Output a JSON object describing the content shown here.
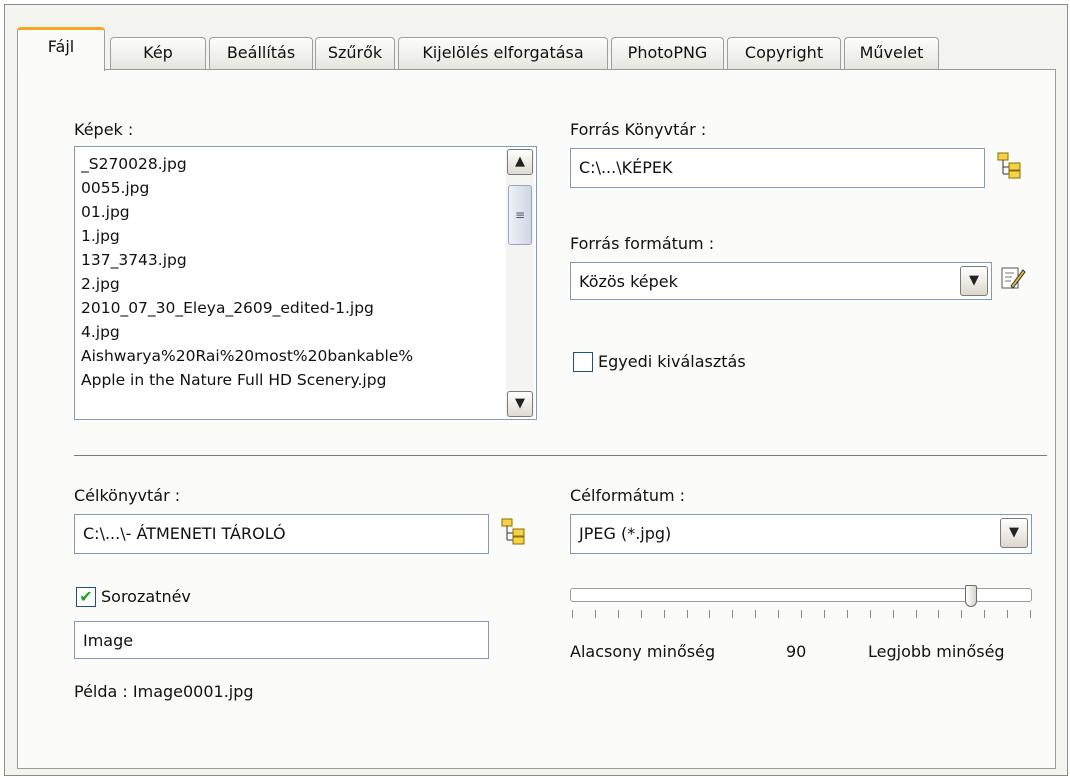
{
  "tabs": [
    "Fájl",
    "Kép",
    "Beállítás",
    "Szűrők",
    "Kijelölés elforgatása",
    "PhotoPNG",
    "Copyright",
    "Művelet"
  ],
  "active_tab": "Fájl",
  "images": {
    "label": "Képek :",
    "items": [
      "_S270028.jpg",
      "0055.jpg",
      "01.jpg",
      "1.jpg",
      "137_3743.jpg",
      "2.jpg",
      "2010_07_30_Eleya_2609_edited-1.jpg",
      "4.jpg",
      "Aishwarya%20Rai%20most%20bankable%",
      "Apple in the Nature Full HD Scenery.jpg"
    ]
  },
  "source_dir": {
    "label": "Forrás Könyvtár :",
    "value": "C:\\...\\KÉPEK"
  },
  "source_format": {
    "label": "Forrás formátum :",
    "value": "Közös képek"
  },
  "custom_select": {
    "label": "Egyedi kiválasztás",
    "checked": false
  },
  "target_dir": {
    "label": "Célkönyvtár :",
    "value": "C:\\...\\- ÁTMENETI TÁROLÓ"
  },
  "target_format": {
    "label": "Célformátum :",
    "value": "JPEG (*.jpg)"
  },
  "series_name": {
    "label": "Sorozatnév",
    "checked": true,
    "value": "Image"
  },
  "example": "Példa : Image0001.jpg",
  "quality": {
    "low_label": "Alacsony minőség",
    "high_label": "Legjobb minőség",
    "value": "90",
    "fraction": 0.88
  },
  "icons": {
    "folder": "folder-tree-icon",
    "edit": "edit-icon",
    "check": "✔",
    "scroll_up": "▲",
    "scroll_down": "▼",
    "dropdown": "▼"
  },
  "colors": {
    "accent_tab": "#f5a623",
    "check": "#21a121",
    "field_border": "#7f9db9"
  }
}
